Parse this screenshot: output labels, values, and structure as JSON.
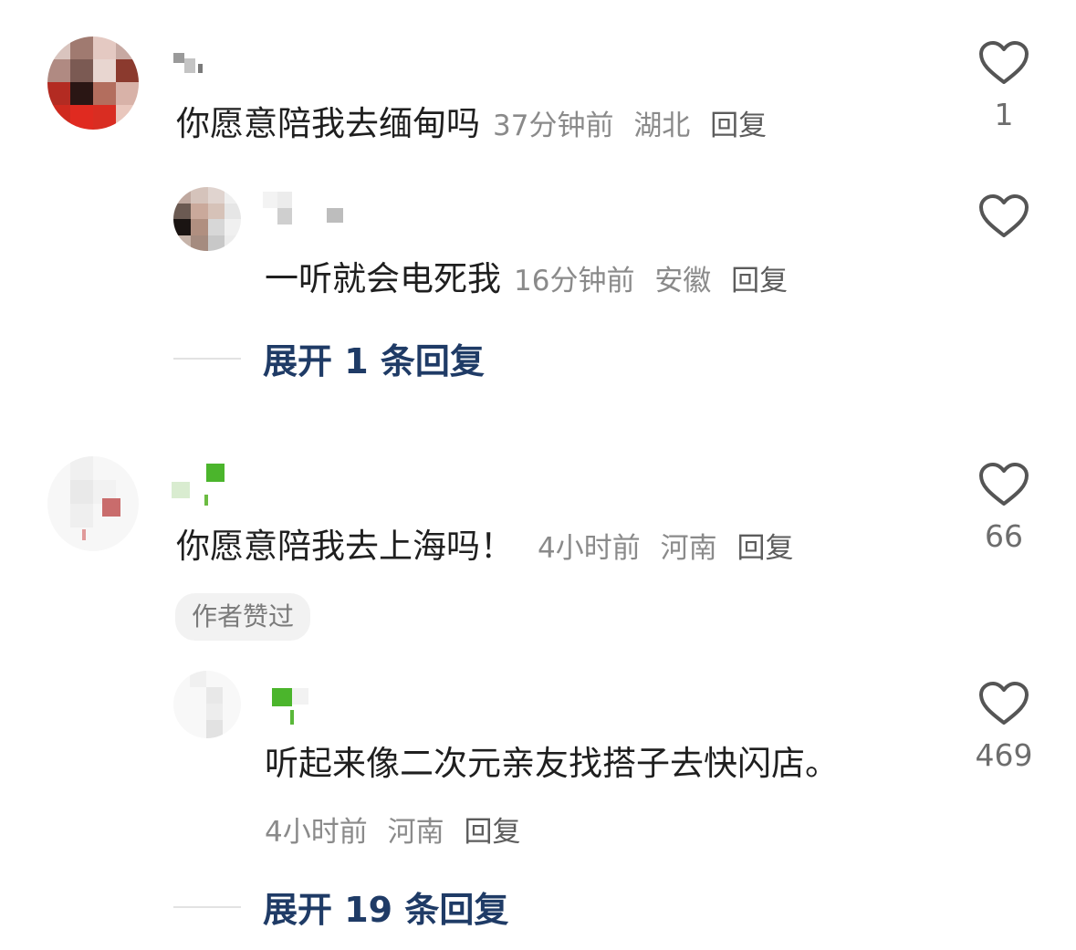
{
  "comments": [
    {
      "text": "你愿意陪我去缅甸吗",
      "time": "37分钟前",
      "location": "湖北",
      "reply_label": "回复",
      "likes": "1",
      "reply": {
        "text": "一听就会电死我",
        "time": "16分钟前",
        "location": "安徽",
        "reply_label": "回复"
      },
      "expand_label": "展开 1 条回复"
    },
    {
      "text": "你愿意陪我去上海吗！",
      "time": "4小时前",
      "location": "河南",
      "reply_label": "回复",
      "likes": "66",
      "badge": "作者赞过",
      "reply": {
        "text": "听起来像二次元亲友找搭子去快闪店。",
        "time": "4小时前",
        "location": "河南",
        "reply_label": "回复",
        "likes": "469"
      },
      "expand_label": "展开 19 条回复"
    }
  ],
  "icons": {
    "like": "heart-outline-icon"
  },
  "colors": {
    "link": "#1f3b66",
    "meta": "#8a8a8a",
    "badge_bg": "#f2f2f2"
  }
}
